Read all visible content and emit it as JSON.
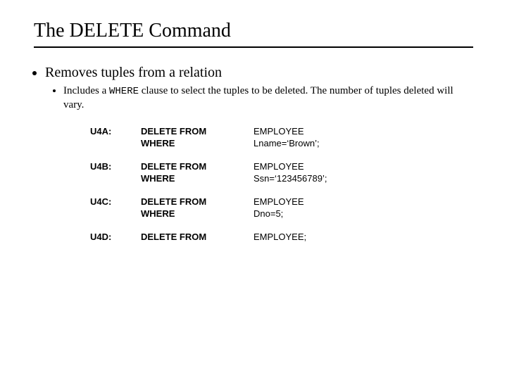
{
  "title": "The DELETE Command",
  "bullet1": "Removes tuples from a relation",
  "sub_pre": "Includes a ",
  "sub_code": "WHERE",
  "sub_post": " clause to select the tuples to be deleted. The number of tuples deleted will vary.",
  "examples": [
    {
      "label": "U4A:",
      "rows": [
        {
          "kw": "DELETE FROM",
          "arg": "EMPLOYEE"
        },
        {
          "kw": "WHERE",
          "arg": "Lname=‘Brown’;"
        }
      ]
    },
    {
      "label": "U4B:",
      "rows": [
        {
          "kw": "DELETE FROM",
          "arg": "EMPLOYEE"
        },
        {
          "kw": "WHERE",
          "arg": "Ssn=‘123456789’;"
        }
      ]
    },
    {
      "label": "U4C:",
      "rows": [
        {
          "kw": "DELETE FROM",
          "arg": "EMPLOYEE"
        },
        {
          "kw": "WHERE",
          "arg": "Dno=5;"
        }
      ]
    },
    {
      "label": "U4D:",
      "rows": [
        {
          "kw": "DELETE FROM",
          "arg": "EMPLOYEE;"
        }
      ]
    }
  ]
}
